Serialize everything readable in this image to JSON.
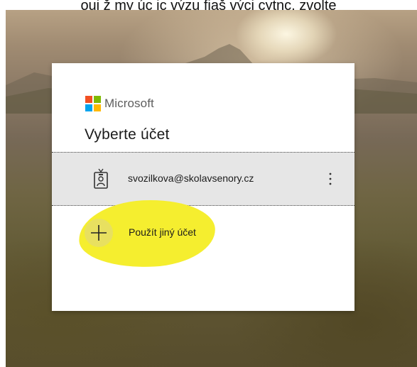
{
  "header_snippet": "oui ž my úc jc výzu fiaš výci cytnc, zvolte",
  "login": {
    "brand": "Microsoft",
    "title": "Vyberte účet",
    "account": {
      "email": "svozilkova@skolavsenory.cz",
      "icon": "badge-icon",
      "more_icon": "more-vertical-icon"
    },
    "use_other": {
      "label": "Použít jiný účet",
      "icon": "plus-icon"
    }
  },
  "colors": {
    "logo_red": "#f25022",
    "logo_green": "#7fba00",
    "logo_blue": "#00a4ef",
    "logo_yellow": "#ffb900",
    "highlight": "#f5ee2f",
    "row_bg": "#e6e6e6"
  }
}
